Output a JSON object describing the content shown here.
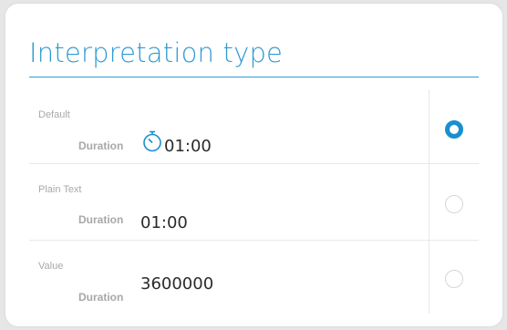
{
  "title": "Interpretation type",
  "accent_color": "#2f9ad4",
  "options": [
    {
      "label": "Default",
      "field_label": "Duration",
      "value": "01:00",
      "icon": "stopwatch-icon",
      "selected": true
    },
    {
      "label": "Plain Text",
      "field_label": "Duration",
      "value": "01:00",
      "selected": false
    },
    {
      "label": "Value",
      "field_label": "Duration",
      "value": "3600000",
      "selected": false
    }
  ]
}
